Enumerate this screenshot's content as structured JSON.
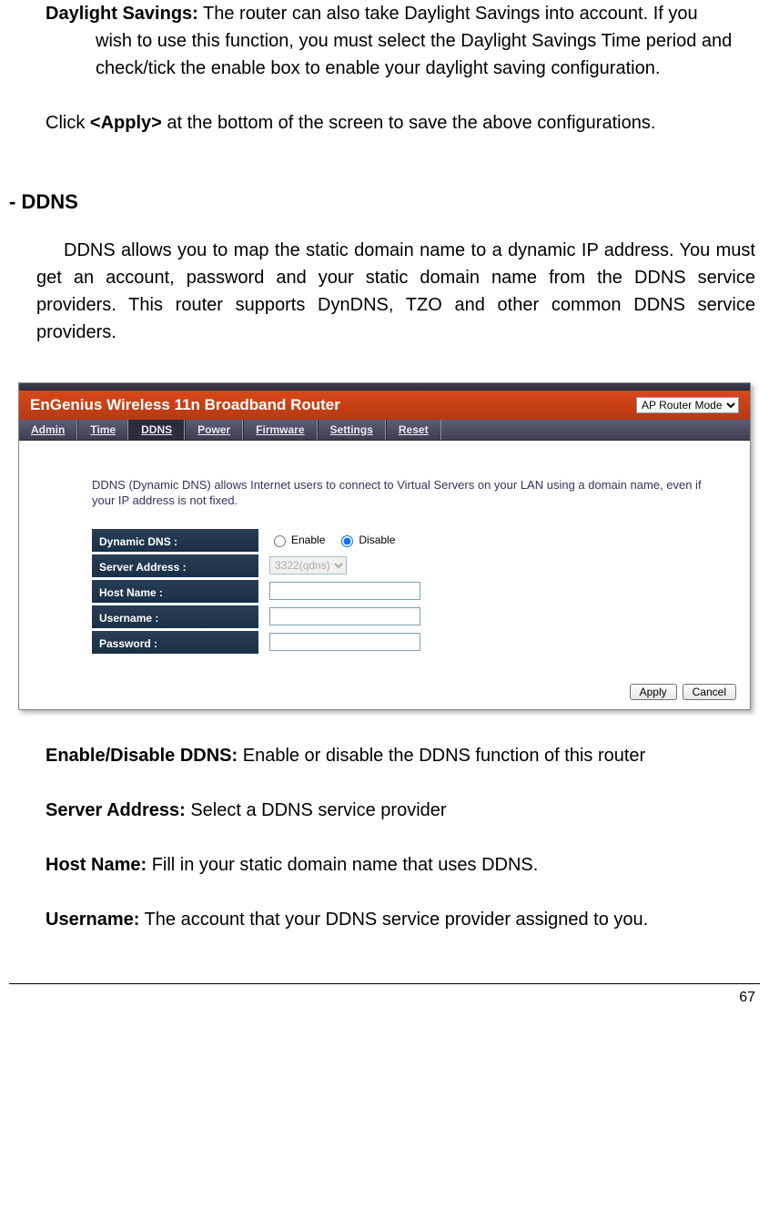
{
  "top": {
    "daylight_label": "Daylight Savings:",
    "daylight_text": " The router can also take Daylight Savings into account. If you wish to use this function, you must select the Daylight Savings Time period and check/tick the enable box to enable your daylight saving configuration.",
    "apply_hint_pre": "Click ",
    "apply_hint_bold": "<Apply>",
    "apply_hint_post": " at the bottom of the screen to save the above configurations."
  },
  "ddns": {
    "heading": "- DDNS",
    "paragraph": "DDNS allows you to map the static domain name to a dynamic IP address. You must get an account, password and your static domain name from the DDNS service providers. This router supports DynDNS, TZO and other common DDNS service providers."
  },
  "screenshot": {
    "title": "EnGenius Wireless 11n Broadband Router",
    "mode_selected": "AP Router Mode",
    "tabs": [
      "Admin",
      "Time",
      "DDNS",
      "Power",
      "Firmware",
      "Settings",
      "Reset"
    ],
    "active_tab_index": 2,
    "description": "DDNS (Dynamic DNS) allows Internet users to connect to Virtual Servers on your LAN using a domain name, even if your IP address is not fixed.",
    "rows": {
      "dynamic_dns": "Dynamic DNS :",
      "enable": "Enable",
      "disable": "Disable",
      "server_address": "Server Address :",
      "server_address_value": "3322(qdns)",
      "host_name": "Host Name :",
      "username": "Username :",
      "password": "Password :"
    },
    "buttons": {
      "apply": "Apply",
      "cancel": "Cancel"
    }
  },
  "definitions": {
    "enable_disable_label": "Enable/Disable DDNS:",
    "enable_disable_text": " Enable or disable the DDNS function of this router",
    "server_address_label": "Server Address:",
    "server_address_text": " Select a DDNS service provider",
    "host_name_label": "Host Name:",
    "host_name_text": " Fill in your static domain name that uses DDNS.",
    "username_label": "Username:",
    "username_text": " The account that your DDNS service provider assigned to you."
  },
  "page_number": "67"
}
